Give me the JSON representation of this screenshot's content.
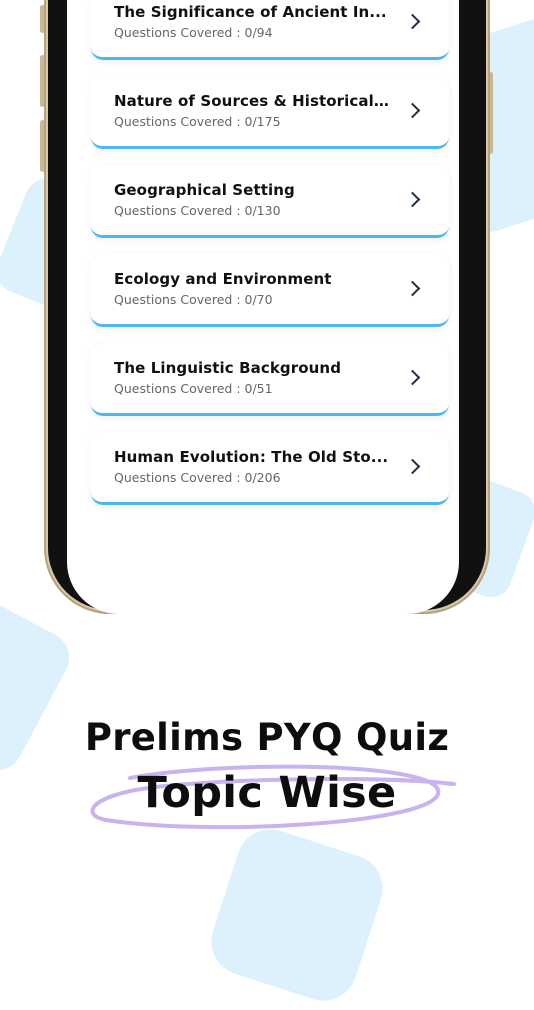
{
  "topics": [
    {
      "title": "The Significance of Ancient In...",
      "covered_label": "Questions Covered : 0/94"
    },
    {
      "title": "Nature of Sources & Historical...",
      "covered_label": "Questions Covered : 0/175"
    },
    {
      "title": "Geographical Setting",
      "covered_label": "Questions Covered : 0/130"
    },
    {
      "title": "Ecology and Environment",
      "covered_label": "Questions Covered : 0/70"
    },
    {
      "title": "The Linguistic Background",
      "covered_label": "Questions Covered : 0/51"
    },
    {
      "title": "Human Evolution: The Old Sto...",
      "covered_label": "Questions Covered : 0/206"
    }
  ],
  "promo": {
    "headline": "Prelims PYQ Quiz",
    "subheadline": "Topic Wise"
  },
  "colors": {
    "accent": "#4bb9ef",
    "highlight": "#c9b3ee",
    "background_shape": "#dcf1fc",
    "phone_frame": "#d7c8a9"
  },
  "icons": {
    "row_action": "chevron-right-icon"
  }
}
